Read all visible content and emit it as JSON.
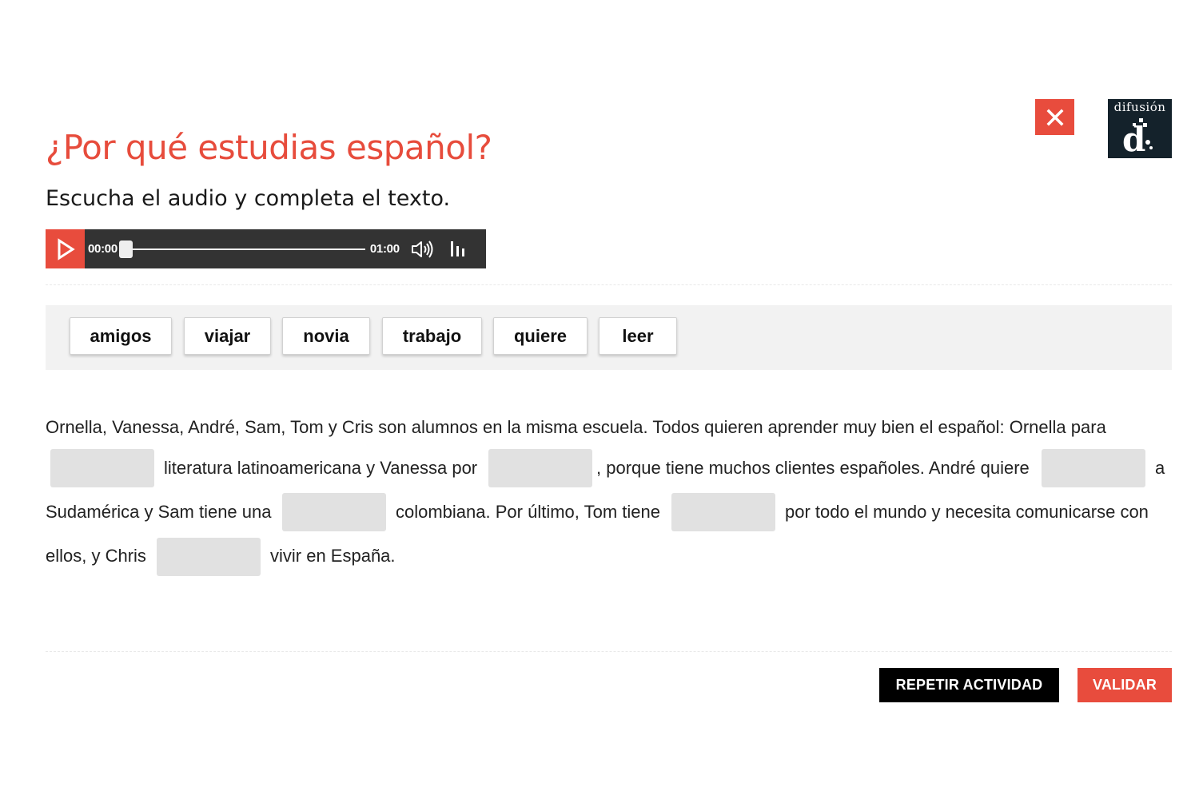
{
  "header": {
    "title": "¿Por qué estudias español?",
    "instruction": "Escucha el audio y completa el texto.",
    "logo_text": "difusión",
    "icons": {
      "close": "close-icon",
      "logo": "difusion-logo-icon"
    },
    "colors": {
      "accent": "#e84c3d",
      "logo_bg": "#14222b",
      "player_bg": "#333333"
    }
  },
  "player": {
    "current_time": "00:00",
    "duration": "01:00",
    "progress": 0,
    "icons": [
      "play-icon",
      "volume-icon",
      "equalizer-icon"
    ]
  },
  "word_bank": {
    "words": [
      "amigos",
      "viajar",
      "novia",
      "trabajo",
      "quiere",
      "leer"
    ]
  },
  "passage": {
    "line1": "Ornella, Vanessa, André, Sam, Tom y Cris son alumnos en la misma escuela. Todos quieren aprender muy bien el español: Ornella para",
    "seg1": "literatura latinoamericana y Vanessa por",
    "seg2": ", porque tiene muchos clientes españoles. André quiere",
    "seg3": "a",
    "seg4": "Sudamérica y Sam tiene una",
    "seg5": "colombiana. Por último, Tom tiene",
    "seg6": "por todo el mundo y necesita comunicarse con",
    "seg7": "ellos, y Chris",
    "seg8": "vivir en España."
  },
  "actions": {
    "repeat_label": "REPETIR ACTIVIDAD",
    "validate_label": "VALIDAR"
  }
}
